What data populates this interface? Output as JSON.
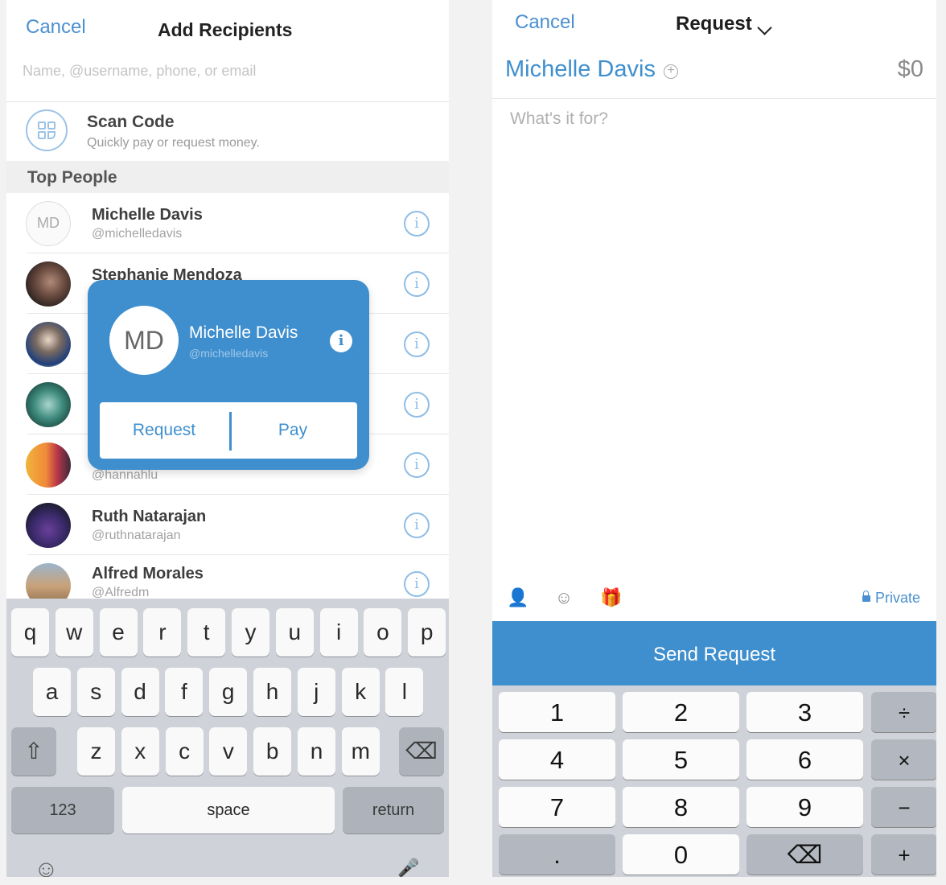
{
  "left": {
    "cancel_label": "Cancel",
    "title": "Add Recipients",
    "search_placeholder": "Name, @username, phone, or email",
    "scan_code": {
      "title": "Scan Code",
      "subtitle": "Quickly pay or request money."
    },
    "section_title": "Top People",
    "people": [
      {
        "name": "Michelle Davis",
        "handle": "@michelledavis",
        "initials": "MD",
        "info": "i"
      },
      {
        "name": "Stephanie Mendoza",
        "handle": "",
        "initials": "",
        "info": "i"
      },
      {
        "name": "",
        "handle": "",
        "initials": "",
        "info": "i"
      },
      {
        "name": "",
        "handle": "",
        "initials": "",
        "info": "i"
      },
      {
        "name": "",
        "handle": "@hannahlu",
        "initials": "",
        "info": "i"
      },
      {
        "name": "Ruth Natarajan",
        "handle": "@ruthnatarajan",
        "initials": "",
        "info": "i"
      },
      {
        "name": "Alfred Morales",
        "handle": "@Alfredm",
        "initials": "",
        "info": "i"
      }
    ],
    "popup": {
      "initials": "MD",
      "name": "Michelle Davis",
      "handle": "@michelledavis",
      "info": "i",
      "request_label": "Request",
      "pay_label": "Pay"
    },
    "keyboard": {
      "row1": [
        "q",
        "w",
        "e",
        "r",
        "t",
        "y",
        "u",
        "i",
        "o",
        "p"
      ],
      "row2": [
        "a",
        "s",
        "d",
        "f",
        "g",
        "h",
        "j",
        "k",
        "l"
      ],
      "row3": [
        "z",
        "x",
        "c",
        "v",
        "b",
        "n",
        "m"
      ],
      "shift": "⇧",
      "delete": "⌫",
      "numbers": "123",
      "space": "space",
      "return": "return",
      "emoji": "☺",
      "mic": "🎤"
    }
  },
  "right": {
    "cancel_label": "Cancel",
    "title": "Request",
    "recipient": "Michelle Davis",
    "add_icon": "+",
    "amount": "$0",
    "note_placeholder": "What's it for?",
    "tools": {
      "contact": "👤",
      "emoji": "☺",
      "sticker": "🎁"
    },
    "privacy": "Private",
    "send_label": "Send Request",
    "numpad": [
      [
        "1",
        "2",
        "3",
        "÷"
      ],
      [
        "4",
        "5",
        "6",
        "×"
      ],
      [
        "7",
        "8",
        "9",
        "−"
      ],
      [
        ".",
        "0",
        "⌫",
        "+"
      ]
    ]
  },
  "colors": {
    "accent": "#3f8fce",
    "link": "#4a90d0"
  }
}
